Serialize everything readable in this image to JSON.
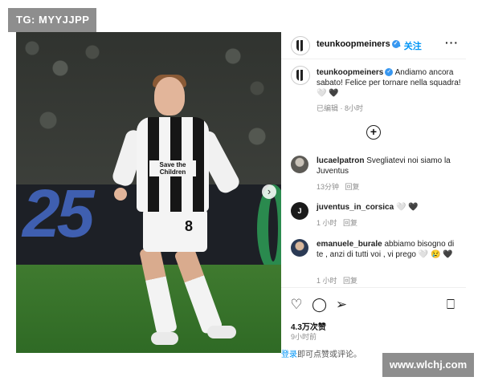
{
  "watermarks": {
    "top_left": "TG: MYYJJPP",
    "bottom_right": "www.wlchj.com"
  },
  "photo": {
    "board_number": "25",
    "sponsor_line1": "Save the",
    "sponsor_line2": "Children",
    "shorts_number": "8"
  },
  "header": {
    "username": "teunkoopmeiners",
    "follow_label": "关注",
    "more_label": "···"
  },
  "caption": {
    "username": "teunkoopmeiners",
    "text": "Andiamo ancora sabato! Felice per tornare nella squadra! 🤍 🖤",
    "meta": "已编辑 · 8小时"
  },
  "comments": [
    {
      "username": "lucaelpatron",
      "text": "Svegliatevi noi siamo la Juventus",
      "time": "13分钟",
      "reply": "回复"
    },
    {
      "username": "juventus_in_corsica",
      "text": "🤍 🖤",
      "time": "1 小时",
      "reply": "回复"
    },
    {
      "username": "emanuele_burale",
      "text": "abbiamo bisogno di te , anzi di tutti voi , vi prego 🤍 😢 🖤",
      "time": "1 小时",
      "reply": "回复"
    }
  ],
  "engagement": {
    "likes": "4.3万次赞",
    "time": "9小时前"
  },
  "login_prompt": {
    "link": "登录",
    "text": "即可点赞或评论。"
  },
  "icons": [
    "heart-icon",
    "comment-icon",
    "share-icon",
    "bookmark-icon",
    "add-comment-icon",
    "verified-icon",
    "more-icon",
    "next-icon"
  ],
  "colors": {
    "accent": "#0095f6",
    "verified": "#3897f0"
  }
}
